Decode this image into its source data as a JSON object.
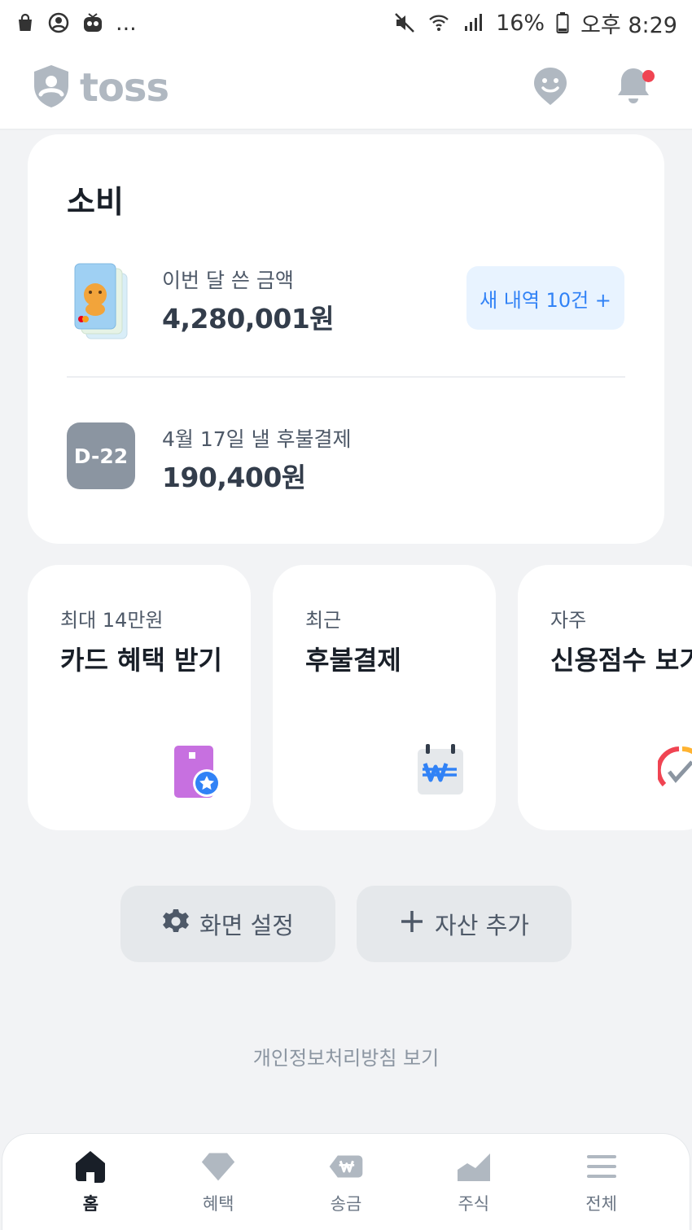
{
  "status_bar": {
    "more": "...",
    "battery": "16%",
    "time": "오후 8:29"
  },
  "header": {
    "logo_text": "toss"
  },
  "summary": {
    "title": "소비",
    "month_label": "이번 달 쓴 금액",
    "month_amount": "4,280,001원",
    "new_button": "새 내역 10건 +",
    "dday_badge": "D-22",
    "bnpl_label": "4월 17일 낼 후불결제",
    "bnpl_amount": "190,400원"
  },
  "tiles": [
    {
      "sub": "최대 14만원",
      "title": "카드 혜택 받기",
      "icon": "card-star-icon"
    },
    {
      "sub": "최근",
      "title": "후불결제",
      "icon": "won-calendar-icon"
    },
    {
      "sub": "자주",
      "title": "신용점수 보기",
      "icon": "credit-gauge-icon"
    }
  ],
  "actions": {
    "settings": "화면 설정",
    "add_asset": "자산 추가"
  },
  "footer": {
    "privacy": "개인정보처리방침 보기"
  },
  "tabbar": [
    {
      "label": "홈",
      "icon": "home-icon",
      "active": true
    },
    {
      "label": "혜택",
      "icon": "diamond-icon"
    },
    {
      "label": "송금",
      "icon": "won-transfer-icon"
    },
    {
      "label": "주식",
      "icon": "stock-chart-icon"
    },
    {
      "label": "전체",
      "icon": "menu-icon"
    }
  ],
  "colors": {
    "accent_blue": "#3182f6",
    "background": "#f2f3f5",
    "badge_gray": "#8b95a1",
    "notification_red": "#f04452"
  }
}
